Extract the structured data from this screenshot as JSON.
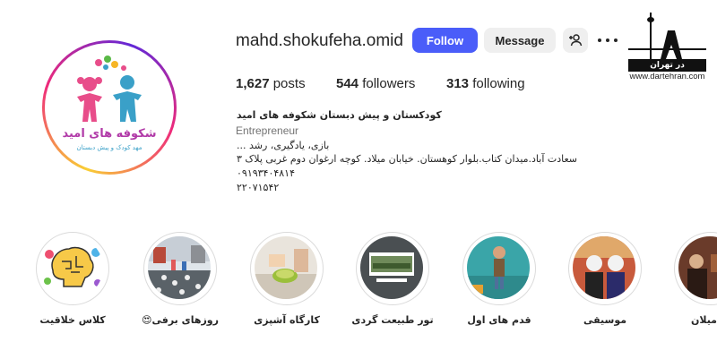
{
  "profile": {
    "username": "mahd.shokufeha.omid",
    "follow_label": "Follow",
    "message_label": "Message",
    "logo_text": "شکوفه های امید",
    "logo_subtext": "مهد کودک و پیش دبستان"
  },
  "stats": {
    "posts_count": "1,627",
    "posts_label": "posts",
    "followers_count": "544",
    "followers_label": "followers",
    "following_count": "313",
    "following_label": "following"
  },
  "bio": {
    "name": "کودکستان و پیش دبستان شکوفه های امید",
    "category": "Entrepreneur",
    "line1": "بازی، یادگیری، رشد ...",
    "line2": "سعادت آباد.میدان کتاب.بلوار کوهستان. خیابان میلاد. کوچه ارغوان دوم غربی پلاک ۳",
    "line3": "۰۹۱۹۳۴۰۴۸۱۴",
    "line4": "۲۲۰۷۱۵۴۲"
  },
  "watermark": {
    "logo_text": "در تهران",
    "url": "www.dartehran.com"
  },
  "highlights": [
    {
      "label": "کلاس خلاقیت"
    },
    {
      "label": "روزهای برفی😍"
    },
    {
      "label": "کارگاه آشپزی"
    },
    {
      "label": "تور طبیعت گردی"
    },
    {
      "label": "قدم های اول"
    },
    {
      "label": "موسیقی"
    },
    {
      "label": "میلان"
    }
  ],
  "icons": {
    "add_user": "person-plus-icon",
    "more": "more-horizontal-icon"
  },
  "colors": {
    "follow_button": "#4a5df9",
    "secondary_button": "#efefef",
    "category_text": "#737373"
  }
}
